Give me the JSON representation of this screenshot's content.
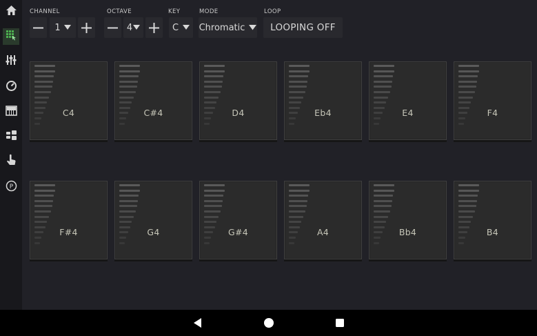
{
  "sidebar": {
    "items": [
      {
        "icon": "home-icon",
        "active": false
      },
      {
        "icon": "pad-grid-icon",
        "active": true
      },
      {
        "icon": "mixer-sliders-icon",
        "active": false
      },
      {
        "icon": "tempo-dial-icon",
        "active": false
      },
      {
        "icon": "keyboard-icon",
        "active": false
      },
      {
        "icon": "stack-icon",
        "active": false
      },
      {
        "icon": "touch-hand-icon",
        "active": false
      },
      {
        "icon": "p-circle-icon",
        "active": false
      }
    ]
  },
  "controls": {
    "channel": {
      "label": "CHANNEL",
      "value": "1",
      "minus": "−",
      "plus": "+"
    },
    "octave": {
      "label": "OCTAVE",
      "value": "4",
      "minus": "−",
      "plus": "+"
    },
    "key": {
      "label": "KEY",
      "value": "C"
    },
    "mode": {
      "label": "MODE",
      "value": "Chromatic"
    },
    "loop": {
      "label": "LOOP",
      "value": "LOOPING OFF"
    }
  },
  "pads": [
    {
      "note": "C4"
    },
    {
      "note": "C#4"
    },
    {
      "note": "D4"
    },
    {
      "note": "Eb4"
    },
    {
      "note": "E4"
    },
    {
      "note": "F4"
    },
    {
      "note": "F#4"
    },
    {
      "note": "G4"
    },
    {
      "note": "G#4"
    },
    {
      "note": "A4"
    },
    {
      "note": "Bb4"
    },
    {
      "note": "B4"
    }
  ],
  "navbar": {
    "icons": [
      "back-icon",
      "home-circle-icon",
      "recents-icon"
    ]
  },
  "colors": {
    "background": "#212127",
    "pad": "#2b2b2b",
    "sidebar": "#18181c",
    "active": "#2e7d32"
  }
}
